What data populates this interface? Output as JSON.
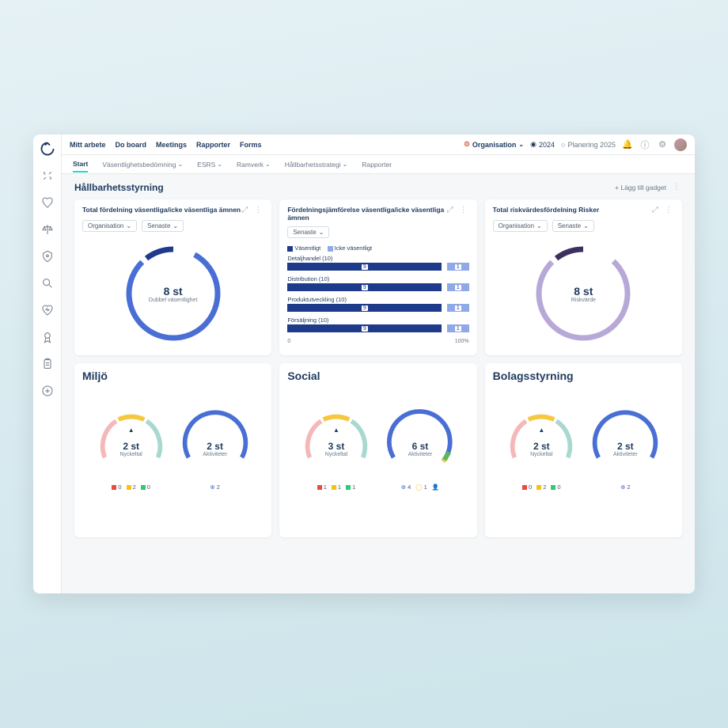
{
  "nav": {
    "items": [
      "Mitt arbete",
      "Do board",
      "Meetings",
      "Rapporter",
      "Forms"
    ],
    "org_label": "Organisation",
    "year": "2024",
    "planning": "Planering 2025"
  },
  "subnav": {
    "items": [
      {
        "label": "Start",
        "active": true
      },
      {
        "label": "Väsentlighetsbedömning",
        "dd": true
      },
      {
        "label": "ESRS",
        "dd": true
      },
      {
        "label": "Ramverk",
        "dd": true
      },
      {
        "label": "Hållbarhetsstrategi",
        "dd": true
      },
      {
        "label": "Rapporter"
      }
    ]
  },
  "page": {
    "title": "Hållbarhetsstyrning",
    "add_gadget": "+ Lägg till gadget"
  },
  "cards": {
    "c1": {
      "title": "Total fördelning väsentliga/icke väsentliga ämnen",
      "f1": "Organisation",
      "f2": "Senaste",
      "value": "8 st",
      "sub": "Dubbel väsentlighet"
    },
    "c2": {
      "title": "Fördelningsjämförelse väsentliga/icke väsentliga ämnen",
      "f1": "Senaste",
      "legend_a": "Väsentligt",
      "legend_b": "Icke väsentligt",
      "scale_min": "0",
      "scale_max": "100%"
    },
    "c3": {
      "title": "Total riskvärdesfördelning Risker",
      "f1": "Organisation",
      "f2": "Senaste",
      "value": "8 st",
      "sub": "Riskvärde"
    }
  },
  "chart_data": {
    "type": "bar",
    "categories": [
      "Detaljhandel (10)",
      "Distribution (10)",
      "Produktutveckling (10)",
      "Försäljning (10)"
    ],
    "series": [
      {
        "name": "Väsentligt",
        "values": [
          9,
          9,
          9,
          9
        ],
        "color": "#1e3a8a"
      },
      {
        "name": "Icke väsentligt",
        "values": [
          1,
          1,
          1,
          1
        ],
        "color": "#8fa8e8"
      }
    ],
    "xlim": [
      0,
      100
    ]
  },
  "bottom": {
    "c1": {
      "title": "Miljö",
      "g1_val": "2 st",
      "g1_sub": "Nyckeltal",
      "g2_val": "2 st",
      "g2_sub": "Aktiviteter",
      "ind": [
        {
          "c": "#e74c3c",
          "v": "0"
        },
        {
          "c": "#f1c40f",
          "v": "2"
        },
        {
          "c": "#2ecc71",
          "v": "0"
        }
      ],
      "act": "2"
    },
    "c2": {
      "title": "Social",
      "g1_val": "3 st",
      "g1_sub": "Nyckeltal",
      "g2_val": "6 st",
      "g2_sub": "Aktiviteter",
      "ind": [
        {
          "c": "#e74c3c",
          "v": "1"
        },
        {
          "c": "#f1c40f",
          "v": "1"
        },
        {
          "c": "#2ecc71",
          "v": "1"
        }
      ],
      "act_a": "4",
      "act_b": "1"
    },
    "c3": {
      "title": "Bolagsstyrning",
      "g1_val": "2 st",
      "g1_sub": "Nyckeltal",
      "g2_val": "2 st",
      "g2_sub": "Aktiviteter",
      "ind": [
        {
          "c": "#e74c3c",
          "v": "0"
        },
        {
          "c": "#f1c40f",
          "v": "2"
        },
        {
          "c": "#2ecc71",
          "v": "0"
        }
      ],
      "act": "2"
    }
  },
  "colors": {
    "blue": "#4a6fd4",
    "darkblue": "#1e3a8a",
    "lightblue": "#8fa8e8",
    "purple": "#8b7db8",
    "darkpurple": "#3d2f5f",
    "yellow": "#f5c842",
    "teal": "#a8d8d0",
    "pink": "#f5b8b8",
    "green": "#5cb85c"
  }
}
